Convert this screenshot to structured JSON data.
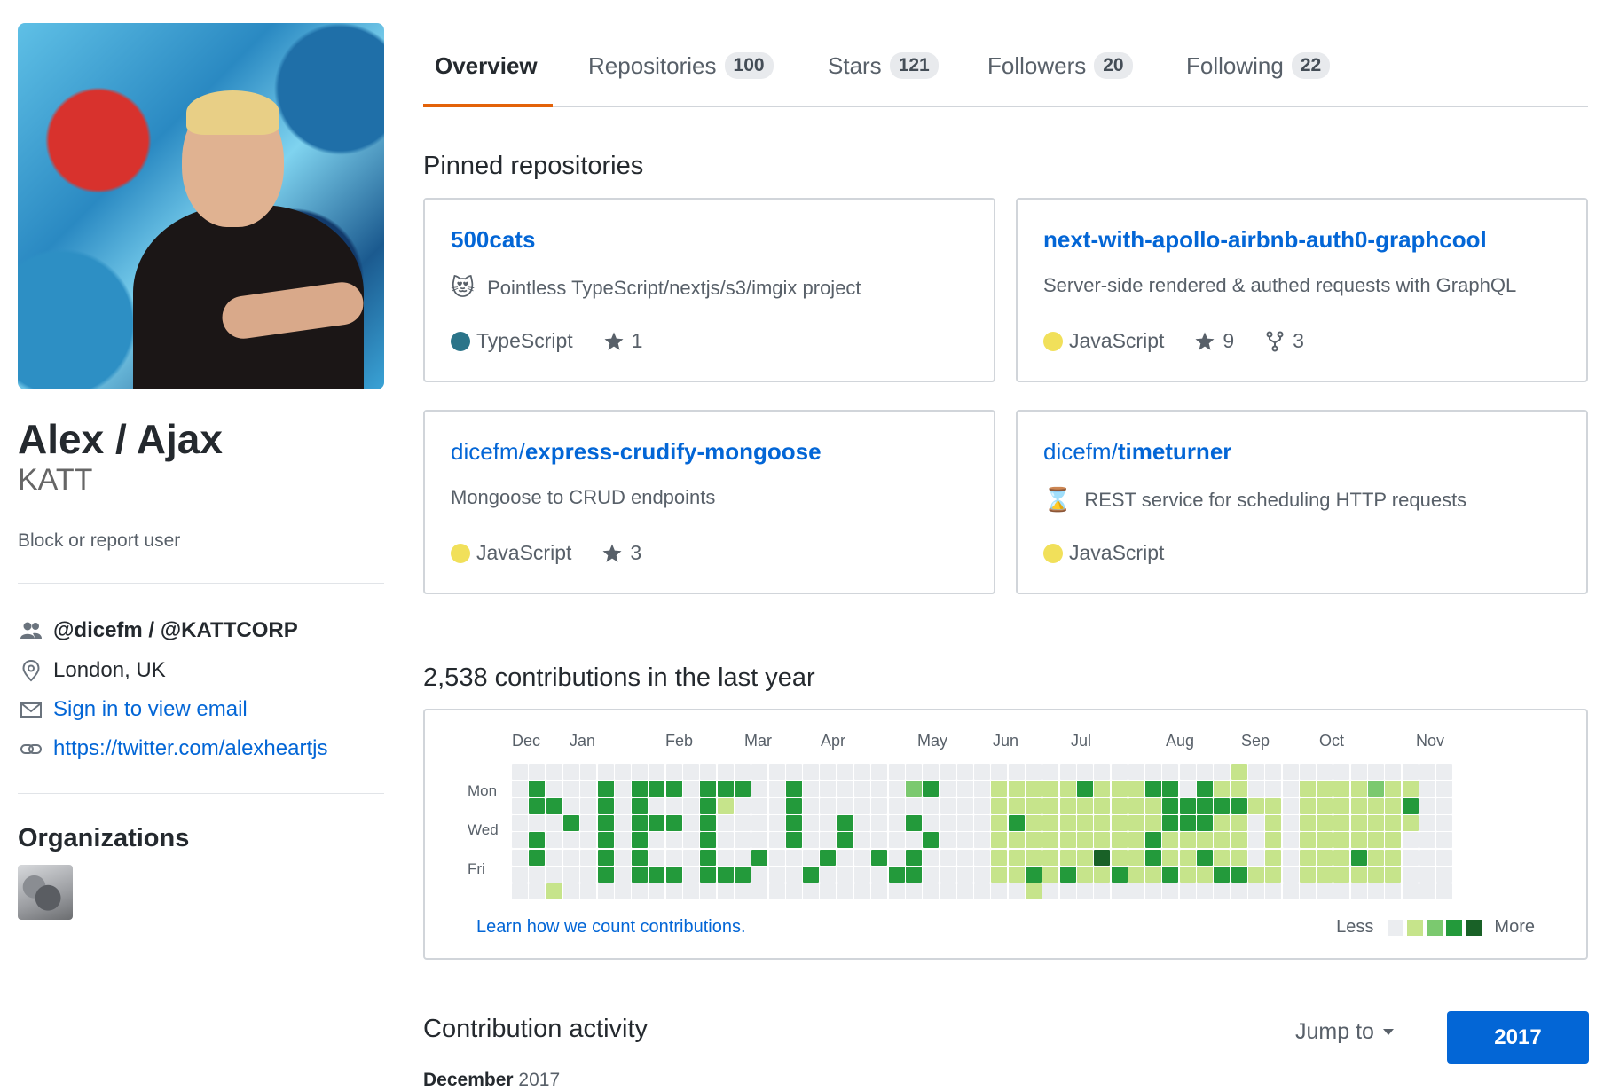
{
  "profile": {
    "name": "Alex / Ajax",
    "username": "KATT",
    "block_label": "Block or report user",
    "organization_text": "@dicefm / @KATTCORP",
    "location": "London, UK",
    "email_label": "Sign in to view email",
    "website": "https://twitter.com/alexheartjs",
    "organizations_title": "Organizations"
  },
  "tabs": [
    {
      "label": "Overview",
      "count": ""
    },
    {
      "label": "Repositories",
      "count": "100"
    },
    {
      "label": "Stars",
      "count": "121"
    },
    {
      "label": "Followers",
      "count": "20"
    },
    {
      "label": "Following",
      "count": "22"
    }
  ],
  "pinned": {
    "title": "Pinned repositories",
    "repos": [
      {
        "owner": "",
        "name": "500cats",
        "emoji": "😻",
        "description": "Pointless TypeScript/nextjs/s3/imgix project",
        "language": "TypeScript",
        "language_color": "#2b7489",
        "stars": "1",
        "forks": ""
      },
      {
        "owner": "",
        "name": "next-with-apollo-airbnb-auth0-graphcool",
        "emoji": "",
        "description": "Server-side rendered & authed requests with GraphQL",
        "language": "JavaScript",
        "language_color": "#f1e05a",
        "stars": "9",
        "forks": "3"
      },
      {
        "owner": "dicefm/",
        "name": "express-crudify-mongoose",
        "emoji": "",
        "description": "Mongoose to CRUD endpoints",
        "language": "JavaScript",
        "language_color": "#f1e05a",
        "stars": "3",
        "forks": ""
      },
      {
        "owner": "dicefm/",
        "name": "timeturner",
        "emoji": "⌛",
        "description": "REST service for scheduling HTTP requests",
        "language": "JavaScript",
        "language_color": "#f1e05a",
        "stars": "",
        "forks": ""
      }
    ]
  },
  "contributions": {
    "title": "2,538 contributions in the last year",
    "months": [
      "Dec",
      "Jan",
      "Feb",
      "Mar",
      "Apr",
      "May",
      "Jun",
      "Jul",
      "Aug",
      "Sep",
      "Oct",
      "Nov"
    ],
    "days": [
      "Mon",
      "Wed",
      "Fri"
    ],
    "learn_link": "Learn how we count contributions.",
    "legend_less": "Less",
    "legend_more": "More",
    "level_colors": [
      "#ebedf0",
      "#c6e48b",
      "#7bc96f",
      "#239a3b",
      "#196127"
    ],
    "grid": [
      "0000000000000000000000000000000000000000001000000000000",
      "0300030333033300300000023000111113111330311000111121100",
      "0330030300031000300000000000111111111133333110111111300",
      "0003030333030000300300030000131111111133311010111111100",
      "0300030300030000300300003000111111111311111010111111000",
      "0300030300030030003003030000111111411311311010111311000",
      "0000030333033300030000330000113131131131133110111111000",
      "0010000000000000000000000000001000000000000000000000000"
    ]
  },
  "activity": {
    "title": "Contribution activity",
    "jump_label": "Jump to",
    "year": "2017",
    "month": "December",
    "month_year": "2017"
  }
}
